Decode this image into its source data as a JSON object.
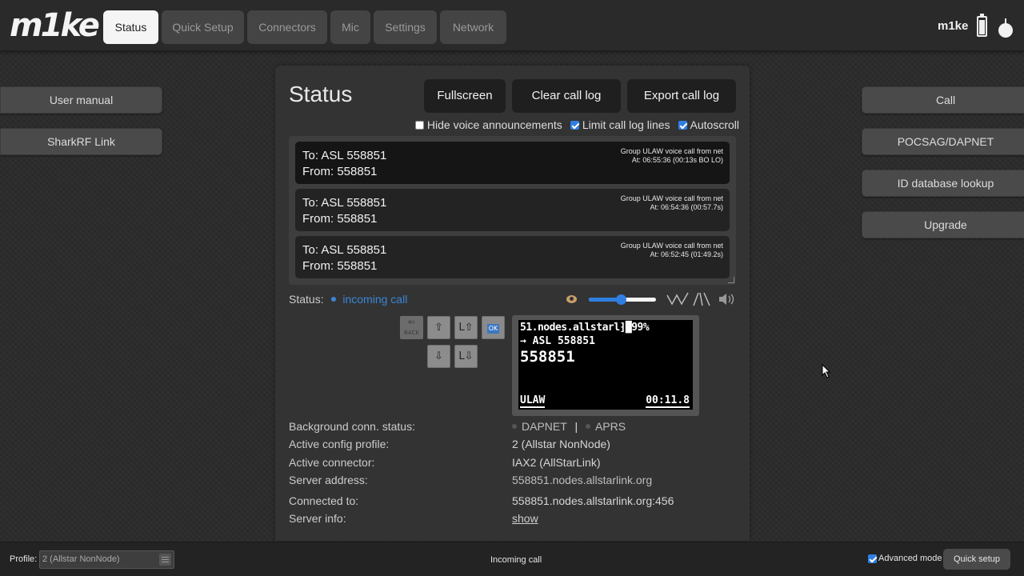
{
  "brand": {
    "logo_text": "m1ke",
    "device_name": "m1ke"
  },
  "nav": {
    "tabs": [
      {
        "label": "Status",
        "active": true
      },
      {
        "label": "Quick Setup"
      },
      {
        "label": "Connectors"
      },
      {
        "label": "Mic"
      },
      {
        "label": "Settings"
      },
      {
        "label": "Network"
      }
    ]
  },
  "left_sidebar": {
    "items": [
      "User manual",
      "SharkRF Link"
    ]
  },
  "right_sidebar": {
    "items": [
      "Call",
      "POCSAG/DAPNET",
      "ID database lookup",
      "Upgrade"
    ]
  },
  "panel": {
    "title": "Status",
    "buttons": {
      "fullscreen": "Fullscreen",
      "clear_log": "Clear call log",
      "export_log": "Export call log"
    },
    "options": {
      "hide_voice": {
        "label": "Hide voice announcements",
        "checked": false
      },
      "limit_lines": {
        "label": "Limit call log lines",
        "checked": true
      },
      "autoscroll": {
        "label": "Autoscroll",
        "checked": true
      }
    },
    "call_log": [
      {
        "to": "To: ASL 558851",
        "from": "From: 558851",
        "type": "Group ULAW voice call from net",
        "time": "At: 06:55:36 (00:13s BO LO)"
      },
      {
        "to": "To: ASL 558851",
        "from": "From: 558851",
        "type": "Group ULAW voice call from net",
        "time": "At: 06:54:36 (00:57.7s)"
      },
      {
        "to": "To: ASL 558851",
        "from": "From: 558851",
        "type": "Group ULAW voice call from net",
        "time": "At: 06:52:45 (01:49.2s)"
      }
    ],
    "status": {
      "label": "Status:",
      "value": "incoming call"
    },
    "volume": {
      "level": 0.48
    },
    "keypad": {
      "back": "BACK",
      "ok": "OK",
      "up": "⇧",
      "l_up": "L⇧",
      "down": "⇩",
      "l_down": "L⇩"
    },
    "lcd": {
      "line1": "51.nodes.allstarl⁆█99%",
      "line2": "→ ASL 558851",
      "line3": "558851",
      "codec": "ULAW",
      "timer": "00:11.8"
    },
    "info": {
      "bg_status": {
        "label": "Background conn. status:",
        "dapnet": "DAPNET",
        "sep": "|",
        "aprs": "APRS"
      },
      "profile": {
        "label": "Active config profile:",
        "value": "2 (Allstar NonNode)"
      },
      "connector": {
        "label": "Active connector:",
        "value": "IAX2 (AllStarLink)"
      },
      "server": {
        "label": "Server address:",
        "value": "558851.nodes.allstarlink.org"
      },
      "connected": {
        "label": "Connected to:",
        "value": "558851.nodes.allstarlink.org:456"
      },
      "server_info": {
        "label": "Server info:",
        "value": "show"
      }
    }
  },
  "footer": {
    "profile_label": "Profile:",
    "profile_value": "2 (Allstar NonNode)",
    "status_text": "Incoming call",
    "advanced_mode": {
      "label": "Advanced mode",
      "checked": true
    },
    "quick_setup": "Quick setup"
  },
  "colors": {
    "accent": "#2f7fe0",
    "status_blue": "#3a86d8"
  }
}
